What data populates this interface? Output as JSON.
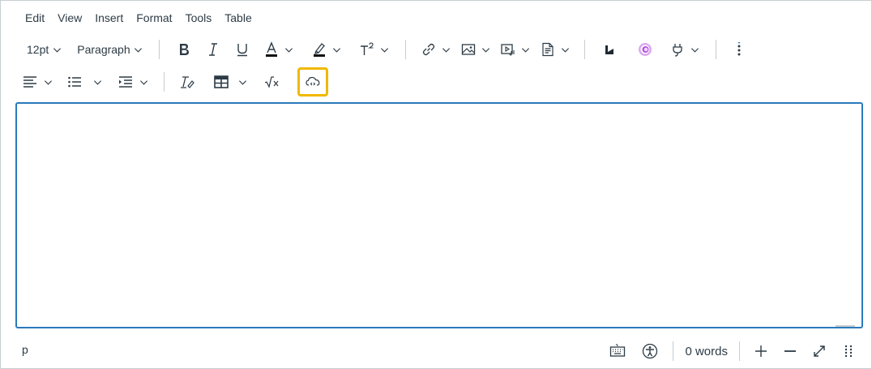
{
  "menubar": {
    "items": [
      "Edit",
      "View",
      "Insert",
      "Format",
      "Tools",
      "Table"
    ]
  },
  "toolbar": {
    "font_size": "12pt",
    "block_format": "Paragraph",
    "text_color": "#111111",
    "highlight_color": "#111111",
    "accent_color": "#2b7abc",
    "focus_highlight_color": "#f0b800",
    "icons": [
      "bold-icon",
      "italic-icon",
      "underline-icon",
      "text-color-icon",
      "highlight-icon",
      "superscript-icon",
      "link-icon",
      "image-icon",
      "media-icon",
      "document-icon",
      "app-a-icon",
      "app-b-icon",
      "plugin-icon",
      "more-icon",
      "align-left-icon",
      "bullet-list-icon",
      "indent-icon",
      "clear-format-icon",
      "table-icon",
      "math-equation-icon",
      "cloud-embed-icon"
    ]
  },
  "editor": {
    "content": ""
  },
  "status": {
    "path": "p",
    "word_count": "0 words"
  }
}
